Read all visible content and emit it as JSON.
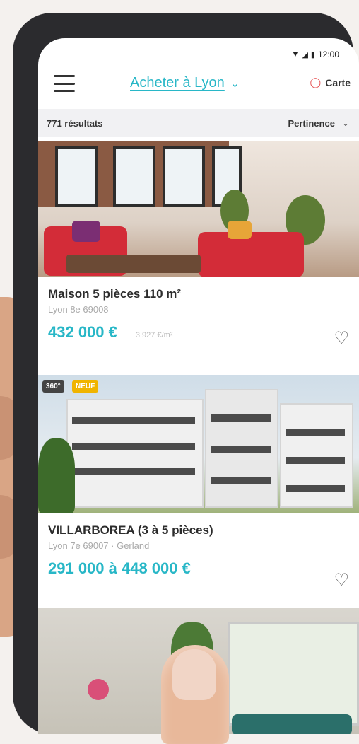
{
  "status_bar": {
    "time": "12:00"
  },
  "header": {
    "title": "Acheter à Lyon",
    "map_label": "Carte"
  },
  "results": {
    "count_label": "771 résultats",
    "sort_label": "Pertinence"
  },
  "listings": [
    {
      "name": "Maison 5 pièces 110 m²",
      "location": "Lyon 8e 69008",
      "price": "432 000 €",
      "price_per_m2": "3 927 €/m²"
    },
    {
      "badge_360": "360°",
      "badge_new": "NEUF",
      "name": "VILLARBOREA (3 à 5 pièces)",
      "location": "Lyon 7e 69007 · Gerland",
      "price": "291 000 à 448 000 €"
    }
  ],
  "icons": {
    "menu": "hamburger-icon",
    "chevron": "chevron-down-icon",
    "map": "map-pin-icon",
    "heart": "heart-outline-icon"
  },
  "colors": {
    "accent": "#28b7c7",
    "map_icon": "#e4484a"
  }
}
